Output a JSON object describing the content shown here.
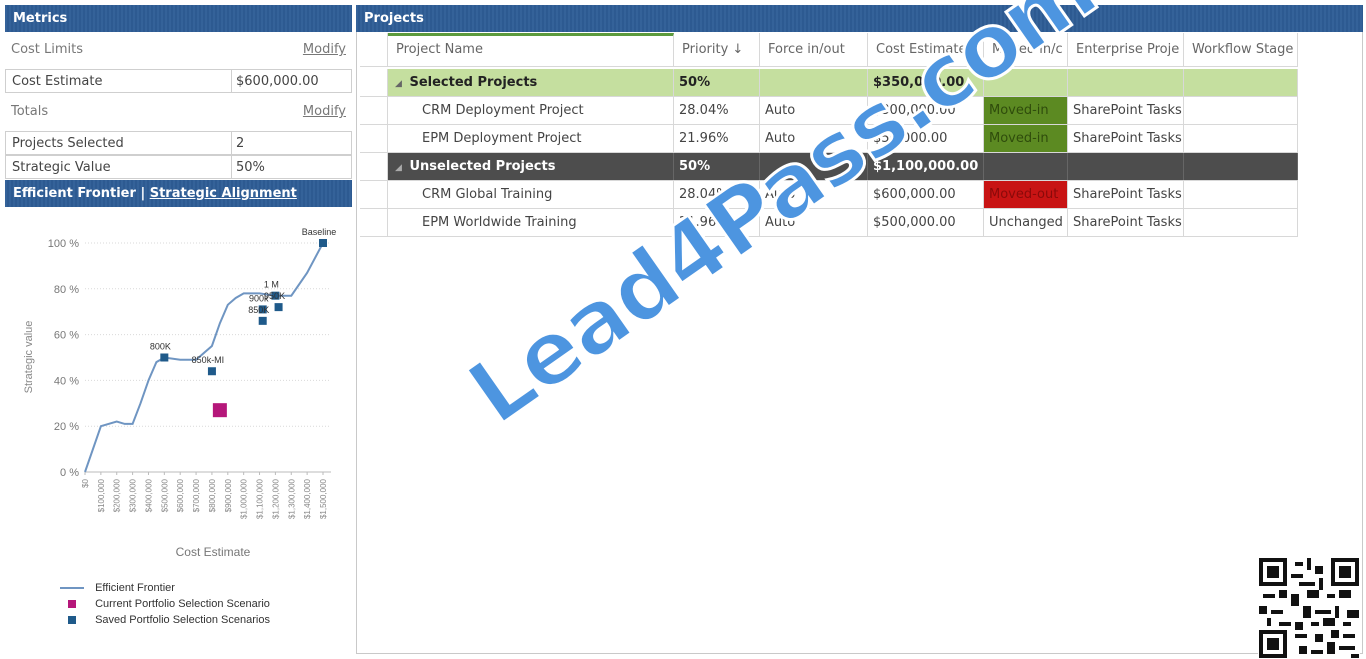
{
  "metrics": {
    "title": "Metrics",
    "cost_limits_label": "Cost Limits",
    "modify_label": "Modify",
    "cost_estimate_label": "Cost Estimate",
    "cost_estimate_value": "$600,000.00",
    "totals_label": "Totals",
    "projects_selected_label": "Projects Selected",
    "projects_selected_value": "2",
    "strategic_value_label": "Strategic Value",
    "strategic_value_value": "50%"
  },
  "frontier": {
    "tab_efficient": "Efficient Frontier",
    "separator": "|",
    "tab_strategic": "Strategic Alignment"
  },
  "chart_data": {
    "type": "line",
    "xlabel": "Cost Estimate",
    "ylabel": "Strategic value",
    "xlim": [
      0,
      1500000
    ],
    "ylim": [
      0,
      100
    ],
    "x_tick_labels": [
      "$0",
      "$100,000",
      "$200,000",
      "$300,000",
      "$400,000",
      "$500,000",
      "$600,000",
      "$700,000",
      "$800,000",
      "$900,000",
      "$1,000,000",
      "$1,100,000",
      "$1,200,000",
      "$1,300,000",
      "$1,400,000",
      "$1,500,000"
    ],
    "y_tick_labels": [
      "0 %",
      "20 %",
      "40 %",
      "60 %",
      "80 %",
      "100 %"
    ],
    "y_ticks": [
      0,
      20,
      40,
      60,
      80,
      100
    ],
    "series": [
      {
        "name": "Efficient Frontier",
        "color": "#6f95c2",
        "x": [
          0,
          100000,
          200000,
          250000,
          300000,
          350000,
          400000,
          450000,
          500000,
          600000,
          700000,
          800000,
          850000,
          900000,
          950000,
          1000000,
          1100000,
          1200000,
          1300000,
          1400000,
          1500000
        ],
        "y": [
          0,
          20,
          22,
          21,
          21,
          30,
          40,
          48,
          50,
          49,
          49,
          55,
          65,
          73,
          76,
          78,
          78,
          77,
          77,
          87,
          100
        ]
      }
    ],
    "saved_scenarios": {
      "name": "Saved Portfolio Selection Scenarios",
      "color": "#1f5a8a",
      "points": [
        {
          "x": 500000,
          "y": 50,
          "label": "800K"
        },
        {
          "x": 800000,
          "y": 44,
          "label": "850k-MI"
        },
        {
          "x": 1120000,
          "y": 71,
          "label": "900k"
        },
        {
          "x": 1120000,
          "y": 66,
          "label": "850K"
        },
        {
          "x": 1200000,
          "y": 77,
          "label": "1 M"
        },
        {
          "x": 1220000,
          "y": 72,
          "label": "950K"
        },
        {
          "x": 1500000,
          "y": 100,
          "label": "Baseline"
        }
      ]
    },
    "current_scenario": {
      "name": "Current Portfolio Selection Scenario",
      "color": "#b5177a",
      "x": 850000,
      "y": 27
    },
    "legend": [
      "Efficient Frontier",
      "Current Portfolio Selection Scenario",
      "Saved Portfolio Selection Scenarios"
    ],
    "legend_position": "bottom-left"
  },
  "projects": {
    "title": "Projects",
    "columns": [
      "Project Name",
      "Priority ↓",
      "Force in/out",
      "Cost Estimate",
      "Moved in/c",
      "Enterprise Proje",
      "Workflow Stage"
    ],
    "groups": [
      {
        "name": "Selected Projects",
        "priority": "50%",
        "cost": "$350,000.00",
        "rows": [
          {
            "name": "CRM Deployment Project",
            "priority": "28.04%",
            "force": "Auto",
            "cost": "$300,000.00",
            "moved": "Moved-in",
            "moved_state": "in",
            "enterprise": "SharePoint Tasks",
            "workflow": ""
          },
          {
            "name": "EPM Deployment Project",
            "priority": "21.96%",
            "force": "Auto",
            "cost": "$50,000.00",
            "moved": "Moved-in",
            "moved_state": "in",
            "enterprise": "SharePoint Tasks",
            "workflow": ""
          }
        ]
      },
      {
        "name": "Unselected Projects",
        "priority": "50%",
        "cost": "$1,100,000.00",
        "rows": [
          {
            "name": "CRM Global Training",
            "priority": "28.04%",
            "force": "Auto",
            "cost": "$600,000.00",
            "moved": "Moved-out",
            "moved_state": "out",
            "enterprise": "SharePoint Tasks",
            "workflow": ""
          },
          {
            "name": "EPM Worldwide Training",
            "priority": "21.96%",
            "force": "Auto",
            "cost": "$500,000.00",
            "moved": "Unchanged",
            "moved_state": "none",
            "enterprise": "SharePoint Tasks",
            "workflow": ""
          }
        ]
      }
    ]
  },
  "watermark": "Lead4Pass.com"
}
